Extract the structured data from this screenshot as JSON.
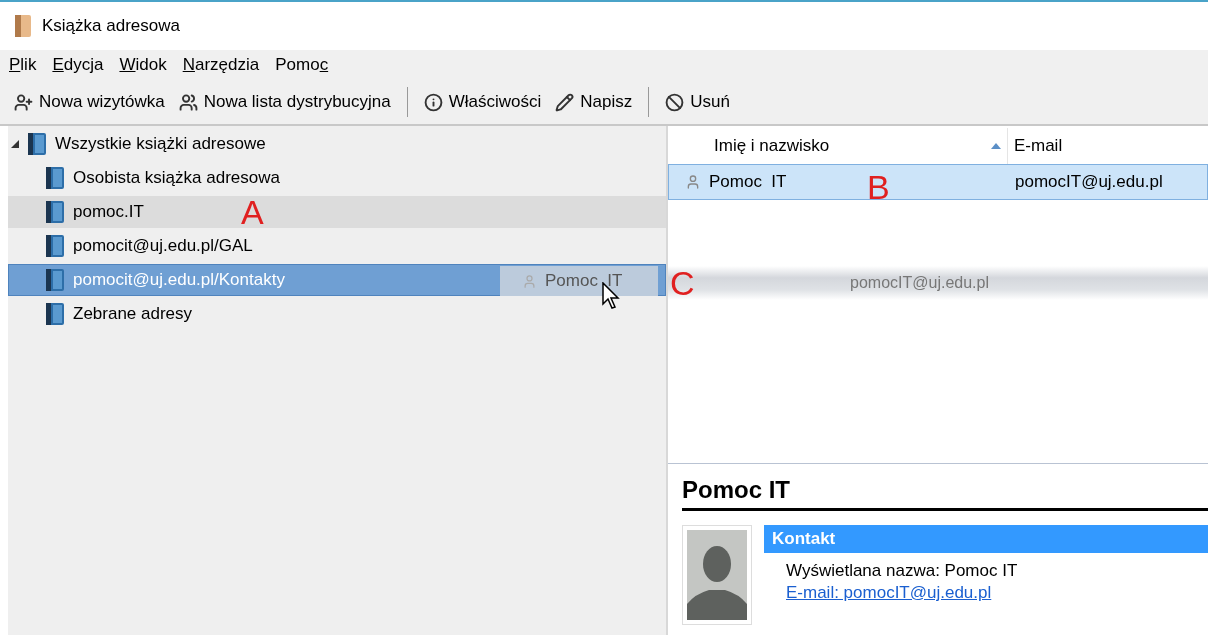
{
  "window": {
    "title": "Książka adresowa"
  },
  "menu": [
    {
      "key": "P",
      "after": "lik"
    },
    {
      "key": "E",
      "after": "dycja"
    },
    {
      "key": "W",
      "after": "idok"
    },
    {
      "key": "N",
      "after": "arzędzia"
    },
    {
      "before": "Pomo",
      "key": "c"
    }
  ],
  "toolbar": [
    {
      "kind": "button",
      "label": "Nowa wizytówka"
    },
    {
      "kind": "button",
      "label": "Nowa lista dystrybucyjna"
    },
    {
      "kind": "separator"
    },
    {
      "kind": "button",
      "label": "Właściwości"
    },
    {
      "kind": "button",
      "label": "Napisz"
    },
    {
      "kind": "separator"
    },
    {
      "kind": "button",
      "label": "Usuń"
    }
  ],
  "tree": [
    {
      "label": "Wszystkie książki adresowe",
      "expanded": true,
      "selected": false,
      "highlighted": false,
      "children": [
        {
          "label": "Osobista książka adresowa",
          "selected": false,
          "highlighted": false
        },
        {
          "label": "pomoc.IT",
          "selected": false,
          "highlighted": true,
          "annotation": "A"
        },
        {
          "label": "pomocit@uj.edu.pl/GAL",
          "selected": false,
          "highlighted": false
        },
        {
          "label": "pomocit@uj.edu.pl/Kontakty",
          "selected": true,
          "highlighted": false
        },
        {
          "label": "Zebrane adresy",
          "selected": false,
          "highlighted": false
        }
      ]
    }
  ],
  "table": {
    "columns": [
      {
        "label": "Imię i nazwisko",
        "sorted": true
      },
      {
        "label": "E-mail",
        "sorted": false
      }
    ],
    "rows": [
      {
        "name": "Pomoc  IT",
        "email": "pomocIT@uj.edu.pl",
        "selected": true,
        "annotation": "B"
      }
    ]
  },
  "drag_ghost": {
    "name": "Pomoc  IT",
    "email": "pomocIT@uj.edu.pl",
    "annotation": "C"
  },
  "detail": {
    "name": "Pomoc IT",
    "section": "Kontakt",
    "display_name": "Wyświetlana nazwa: Pomoc IT",
    "email_link": "E-mail: pomocIT@uj.edu.pl"
  }
}
